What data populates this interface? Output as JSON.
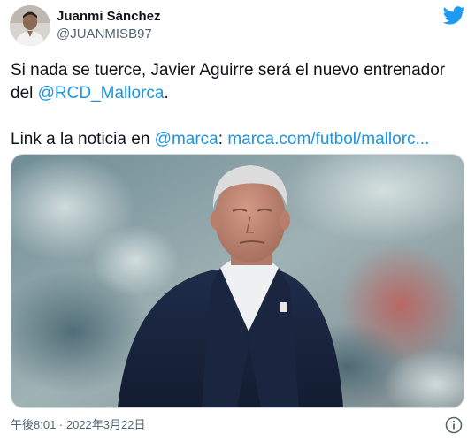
{
  "author": {
    "name": "Juanmi Sánchez",
    "handle": "@JUANMISB97"
  },
  "tweet": {
    "line1_prefix": "Si nada se tuerce, Javier Aguirre será el nuevo entrenador",
    "line2_prefix": "del ",
    "mention_club": "@RCD_Mallorca",
    "line2_suffix": ".",
    "link_prefix": "Link a la noticia en ",
    "mention_source": "@marca",
    "link_colon": ": ",
    "url": "marca.com/futbol/mallorc..."
  },
  "timestamp": "午後8:01 · 2022年3月22日",
  "icons": {
    "brand": "twitter-bird-icon",
    "info": "info-icon"
  },
  "colors": {
    "link": "#1b95e0",
    "twitter_blue": "#1d9bf0",
    "text": "#0f1419",
    "muted": "#536471"
  }
}
